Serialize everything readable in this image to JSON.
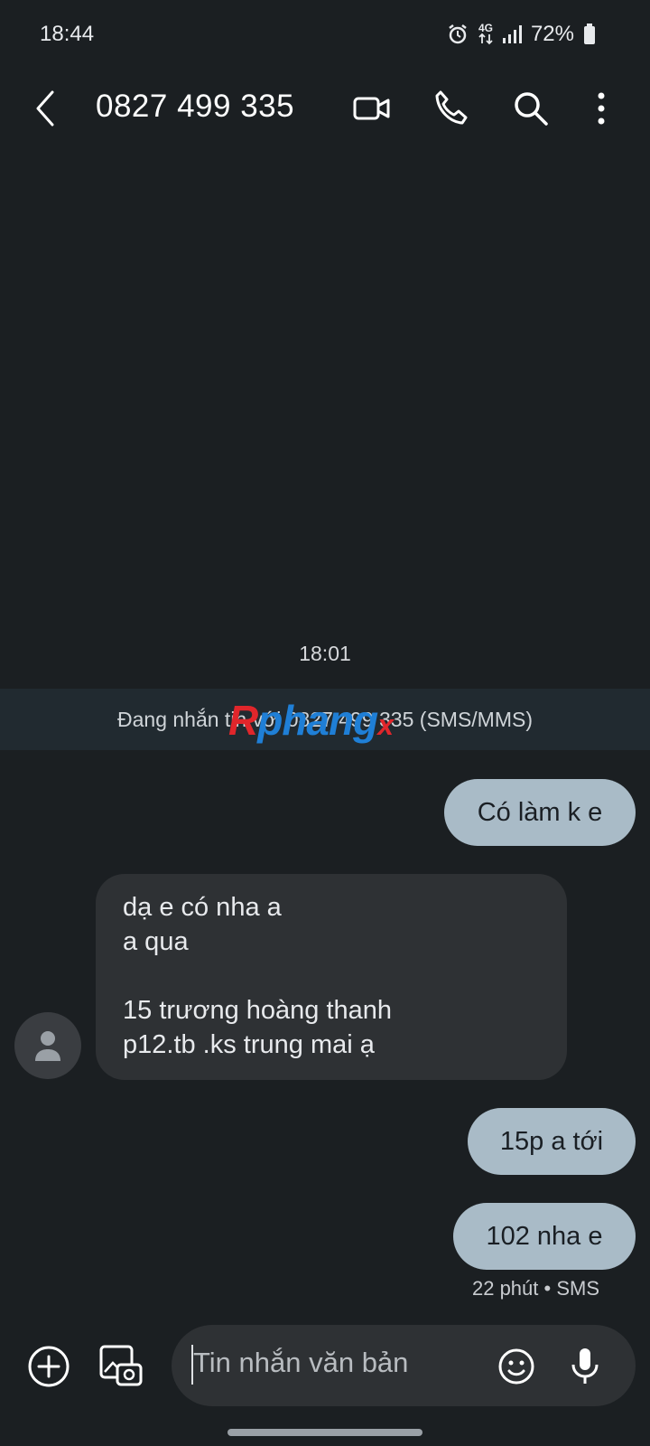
{
  "status_bar": {
    "time": "18:44",
    "network": "4G",
    "battery": "72%",
    "icons": [
      "alarm-icon",
      "data-arrows-icon",
      "signal-icon",
      "battery-icon"
    ]
  },
  "header": {
    "title": "0827 499 335",
    "icons": [
      "back-icon",
      "video-call-icon",
      "phone-call-icon",
      "search-icon",
      "more-icon"
    ]
  },
  "conversation": {
    "timestamp": "18:01",
    "info": "Đang nhắn tin với 0827 499 335 (SMS/MMS)",
    "watermark": {
      "part1": "R",
      "part2": "phang",
      "part3": "x"
    },
    "messages": [
      {
        "direction": "outgoing",
        "text": "Có làm k e"
      },
      {
        "direction": "incoming",
        "lines": [
          "dạ e có nha a",
          "a qua",
          "",
          "15 trương hoàng thanh",
          "p12.tb .ks trung mai ạ"
        ]
      },
      {
        "direction": "outgoing",
        "text": "15p a tới"
      },
      {
        "direction": "outgoing",
        "text": "102 nha e"
      }
    ],
    "last_meta": "22 phút • SMS"
  },
  "composer": {
    "placeholder": "Tin nhắn văn bản",
    "icons": [
      "add-icon",
      "gallery-camera-icon",
      "emoji-icon",
      "microphone-icon"
    ]
  },
  "colors": {
    "background": "#1b1f22",
    "outgoing_bubble": "#a9bbc7",
    "incoming_bubble": "#2e3134",
    "info_bar": "#212a30"
  }
}
